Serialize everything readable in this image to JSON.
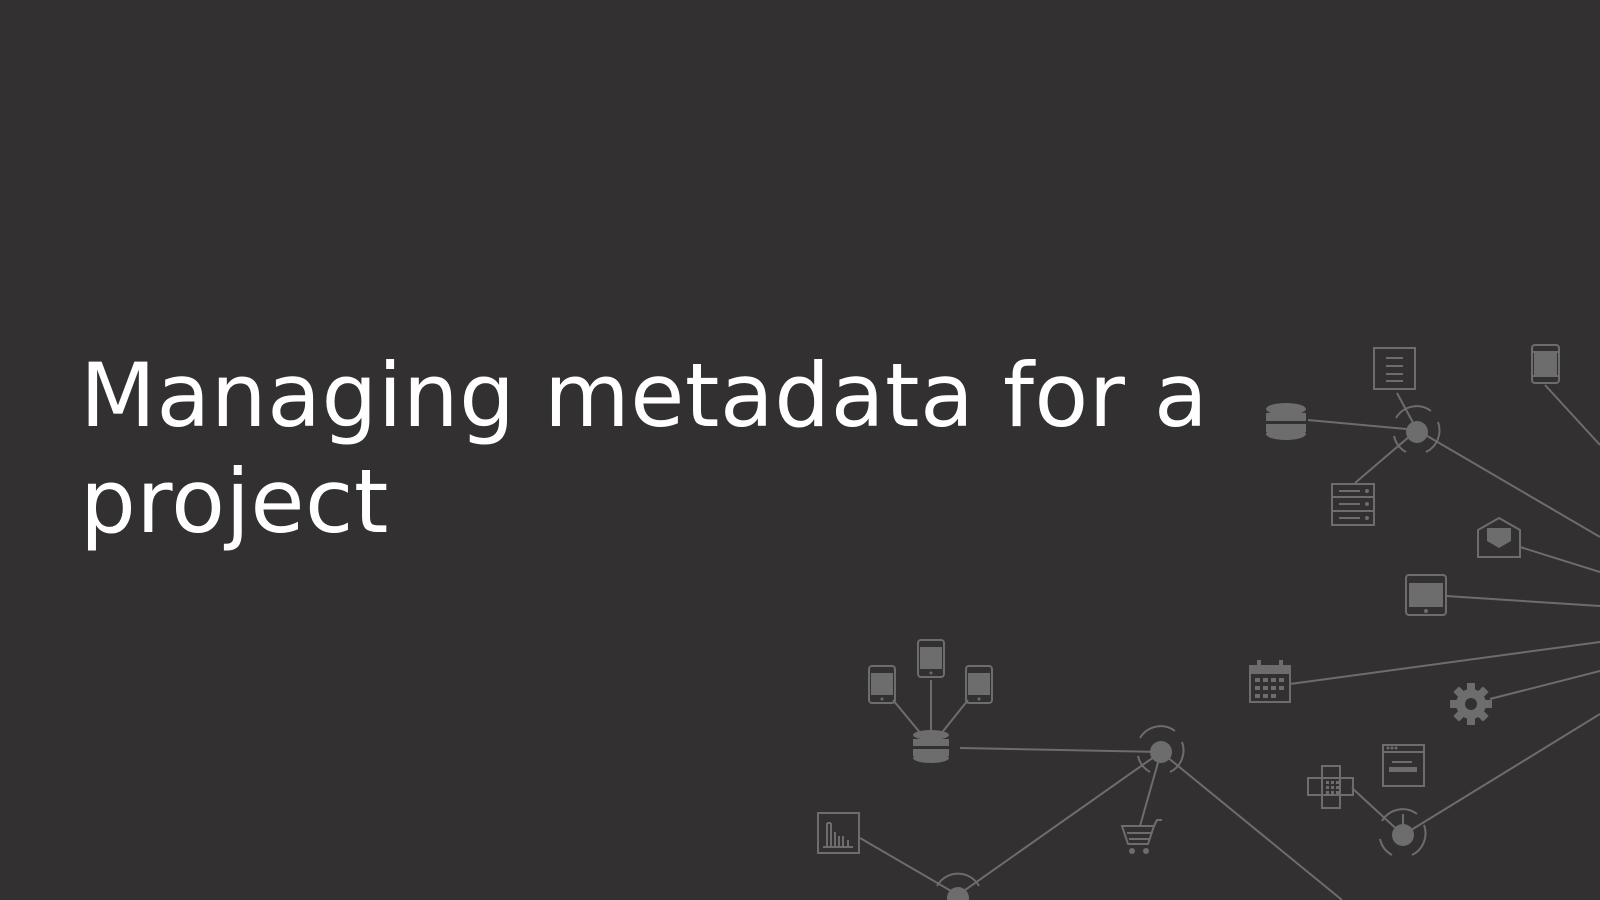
{
  "slide": {
    "title": "Managing metadata for a project",
    "background_color": "#323031",
    "text_color": "#ffffff",
    "graphic_color": "#6d6d6d"
  },
  "network_graphic": {
    "icons": [
      "database-icon",
      "document-icon",
      "phone-icon",
      "hub-icon",
      "server-icon",
      "mail-icon",
      "tablet-icon",
      "calendar-icon",
      "gear-icon",
      "browser-window-icon",
      "fax-icon",
      "bar-chart-icon",
      "shopping-cart-icon",
      "mobile-cluster-icon"
    ]
  }
}
